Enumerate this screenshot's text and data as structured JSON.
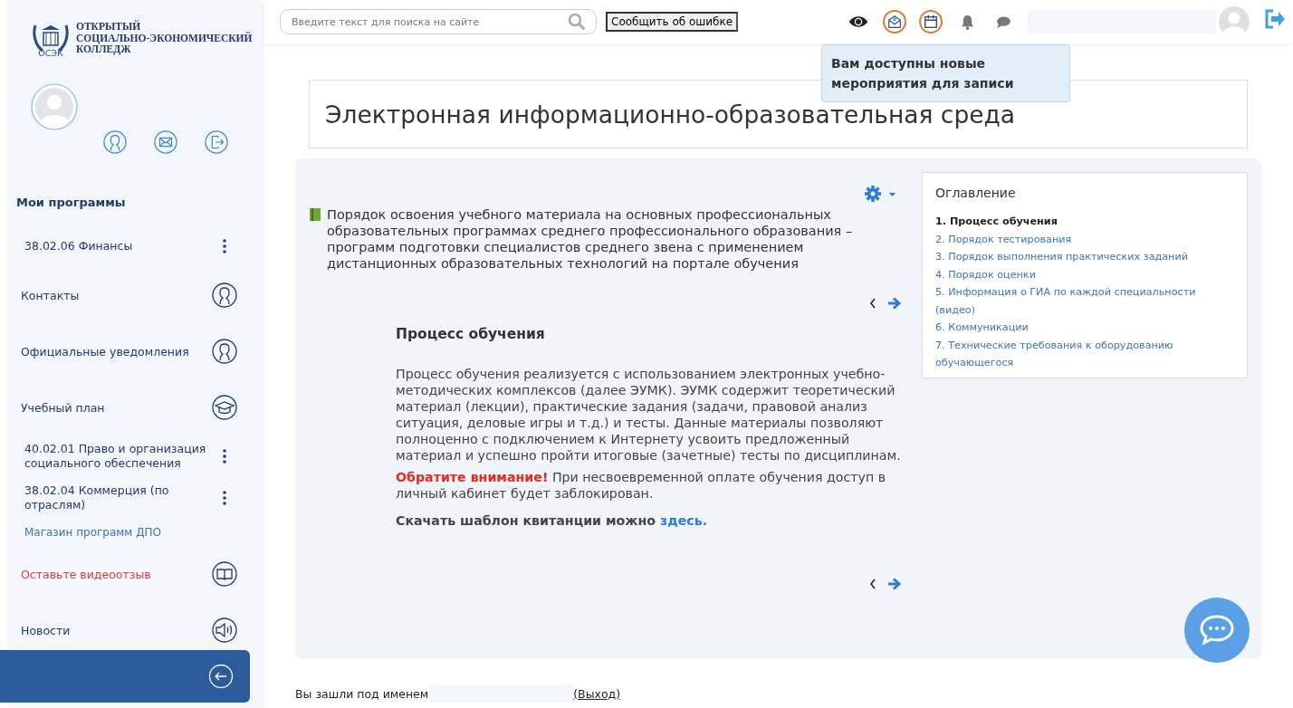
{
  "logo": {
    "lines": [
      "ОТКРЫТЫЙ",
      "СОЦИАЛЬНО-ЭКОНОМИЧЕСКИЙ",
      "КОЛЛЕДЖ"
    ],
    "emblem_text": "ОСЭК"
  },
  "topbar": {
    "search": {
      "placeholder": "Введите текст для поиска на сайте"
    },
    "report_button": "Сообщить об ошибке",
    "icons": [
      {
        "kind": "eye",
        "highlighted": false
      },
      {
        "kind": "mail",
        "highlighted": true
      },
      {
        "kind": "calendar",
        "highlighted": true
      },
      {
        "kind": "bell",
        "highlighted": false
      },
      {
        "kind": "chat",
        "highlighted": false
      }
    ],
    "tooltip": "Вам доступны новые мероприятия для записи"
  },
  "sidebar": {
    "section_title": "Мои программы",
    "items": [
      {
        "kind": "program",
        "label": "38.02.06 Финансы"
      },
      {
        "kind": "contact",
        "label": "Контакты"
      },
      {
        "kind": "contact",
        "label": "Официальные уведомления"
      },
      {
        "kind": "plan",
        "label": "Учебный план"
      },
      {
        "kind": "program",
        "label": "40.02.01 Право и организация социального обеспечения"
      },
      {
        "kind": "program",
        "label": "38.02.04 Коммерция (по отраслям)"
      },
      {
        "kind": "shop",
        "label": "Магазин программ ДПО"
      },
      {
        "kind": "review",
        "label": "Оставьте видеоотзыв"
      },
      {
        "kind": "news",
        "label": "Новости"
      }
    ]
  },
  "main": {
    "title": "Электронная информационно-образовательная среда",
    "intro": "Порядок освоения учебного материала на основных профессиональных образовательных программах среднего профессионального образования – программ подготовки специалистов среднего звена с применением дистанционных образовательных технологий на портале обучения",
    "slide": {
      "heading": "Процесс обучения",
      "paragraph": "Процесс обучения реализуется с использованием электронных учебно-методических комплексов (далее ЭУМК). ЭУМК содержит теоретический материал (лекции), практические задания (задачи, правовой анализ ситуация, деловые игры и т.д.) и тесты. Данные материалы позволяют полноценно с подключением к Интернету усвоить предложенный материал и успешно пройти итоговые (зачетные) тесты по дисциплинам.",
      "notice_label": "Обратите внимание!",
      "notice_text": "При несвоевременной оплате обучения доступ в личный кабинет будет заблокирован.",
      "download_text": "Скачать шаблон квитанции можно",
      "download_link": "здесь."
    },
    "toc": {
      "title": "Оглавление",
      "items": [
        {
          "label": "1. Процесс обучения",
          "selected": true
        },
        {
          "label": "2. Порядок тестирования",
          "selected": false
        },
        {
          "label": "3. Порядок выполнения практических заданий",
          "selected": false
        },
        {
          "label": "4. Порядок оценки",
          "selected": false
        },
        {
          "label": "5. Информация о ГИА по каждой специальности (видео)",
          "selected": false
        },
        {
          "label": "6. Коммуникации",
          "selected": false
        },
        {
          "label": "7. Технические требования к оборудованию обучающегося",
          "selected": false
        }
      ]
    }
  },
  "footer": {
    "logged_in_as": "Вы зашли под именем",
    "logout": "(Выход)"
  }
}
